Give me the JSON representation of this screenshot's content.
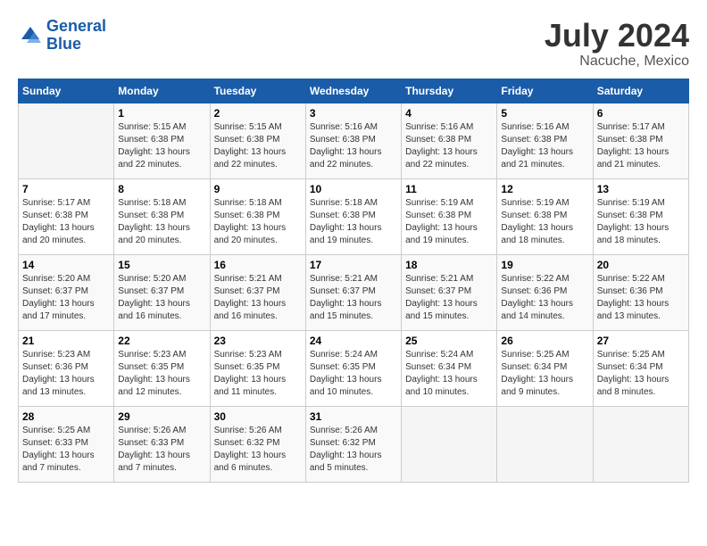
{
  "header": {
    "logo_line1": "General",
    "logo_line2": "Blue",
    "month_year": "July 2024",
    "location": "Nacuche, Mexico"
  },
  "days_of_week": [
    "Sunday",
    "Monday",
    "Tuesday",
    "Wednesday",
    "Thursday",
    "Friday",
    "Saturday"
  ],
  "weeks": [
    [
      {
        "day": "",
        "info": ""
      },
      {
        "day": "1",
        "info": "Sunrise: 5:15 AM\nSunset: 6:38 PM\nDaylight: 13 hours\nand 22 minutes."
      },
      {
        "day": "2",
        "info": "Sunrise: 5:15 AM\nSunset: 6:38 PM\nDaylight: 13 hours\nand 22 minutes."
      },
      {
        "day": "3",
        "info": "Sunrise: 5:16 AM\nSunset: 6:38 PM\nDaylight: 13 hours\nand 22 minutes."
      },
      {
        "day": "4",
        "info": "Sunrise: 5:16 AM\nSunset: 6:38 PM\nDaylight: 13 hours\nand 22 minutes."
      },
      {
        "day": "5",
        "info": "Sunrise: 5:16 AM\nSunset: 6:38 PM\nDaylight: 13 hours\nand 21 minutes."
      },
      {
        "day": "6",
        "info": "Sunrise: 5:17 AM\nSunset: 6:38 PM\nDaylight: 13 hours\nand 21 minutes."
      }
    ],
    [
      {
        "day": "7",
        "info": ""
      },
      {
        "day": "8",
        "info": "Sunrise: 5:18 AM\nSunset: 6:38 PM\nDaylight: 13 hours\nand 20 minutes."
      },
      {
        "day": "9",
        "info": "Sunrise: 5:18 AM\nSunset: 6:38 PM\nDaylight: 13 hours\nand 20 minutes."
      },
      {
        "day": "10",
        "info": "Sunrise: 5:18 AM\nSunset: 6:38 PM\nDaylight: 13 hours\nand 19 minutes."
      },
      {
        "day": "11",
        "info": "Sunrise: 5:19 AM\nSunset: 6:38 PM\nDaylight: 13 hours\nand 19 minutes."
      },
      {
        "day": "12",
        "info": "Sunrise: 5:19 AM\nSunset: 6:38 PM\nDaylight: 13 hours\nand 18 minutes."
      },
      {
        "day": "13",
        "info": "Sunrise: 5:19 AM\nSunset: 6:38 PM\nDaylight: 13 hours\nand 18 minutes."
      }
    ],
    [
      {
        "day": "14",
        "info": ""
      },
      {
        "day": "15",
        "info": "Sunrise: 5:20 AM\nSunset: 6:37 PM\nDaylight: 13 hours\nand 16 minutes."
      },
      {
        "day": "16",
        "info": "Sunrise: 5:21 AM\nSunset: 6:37 PM\nDaylight: 13 hours\nand 16 minutes."
      },
      {
        "day": "17",
        "info": "Sunrise: 5:21 AM\nSunset: 6:37 PM\nDaylight: 13 hours\nand 15 minutes."
      },
      {
        "day": "18",
        "info": "Sunrise: 5:21 AM\nSunset: 6:37 PM\nDaylight: 13 hours\nand 15 minutes."
      },
      {
        "day": "19",
        "info": "Sunrise: 5:22 AM\nSunset: 6:36 PM\nDaylight: 13 hours\nand 14 minutes."
      },
      {
        "day": "20",
        "info": "Sunrise: 5:22 AM\nSunset: 6:36 PM\nDaylight: 13 hours\nand 13 minutes."
      }
    ],
    [
      {
        "day": "21",
        "info": ""
      },
      {
        "day": "22",
        "info": "Sunrise: 5:23 AM\nSunset: 6:35 PM\nDaylight: 13 hours\nand 12 minutes."
      },
      {
        "day": "23",
        "info": "Sunrise: 5:23 AM\nSunset: 6:35 PM\nDaylight: 13 hours\nand 11 minutes."
      },
      {
        "day": "24",
        "info": "Sunrise: 5:24 AM\nSunset: 6:35 PM\nDaylight: 13 hours\nand 10 minutes."
      },
      {
        "day": "25",
        "info": "Sunrise: 5:24 AM\nSunset: 6:34 PM\nDaylight: 13 hours\nand 10 minutes."
      },
      {
        "day": "26",
        "info": "Sunrise: 5:25 AM\nSunset: 6:34 PM\nDaylight: 13 hours\nand 9 minutes."
      },
      {
        "day": "27",
        "info": "Sunrise: 5:25 AM\nSunset: 6:34 PM\nDaylight: 13 hours\nand 8 minutes."
      }
    ],
    [
      {
        "day": "28",
        "info": "Sunrise: 5:25 AM\nSunset: 6:33 PM\nDaylight: 13 hours\nand 7 minutes."
      },
      {
        "day": "29",
        "info": "Sunrise: 5:26 AM\nSunset: 6:33 PM\nDaylight: 13 hours\nand 7 minutes."
      },
      {
        "day": "30",
        "info": "Sunrise: 5:26 AM\nSunset: 6:32 PM\nDaylight: 13 hours\nand 6 minutes."
      },
      {
        "day": "31",
        "info": "Sunrise: 5:26 AM\nSunset: 6:32 PM\nDaylight: 13 hours\nand 5 minutes."
      },
      {
        "day": "",
        "info": ""
      },
      {
        "day": "",
        "info": ""
      },
      {
        "day": "",
        "info": ""
      }
    ]
  ],
  "week7_sunday": "Sunrise: 5:17 AM\nSunset: 6:38 PM\nDaylight: 13 hours\nand 20 minutes.",
  "week14_sunday": "Sunrise: 5:20 AM\nSunset: 6:37 PM\nDaylight: 13 hours\nand 17 minutes.",
  "week21_sunday": "Sunrise: 5:23 AM\nSunset: 6:36 PM\nDaylight: 13 hours\nand 13 minutes."
}
